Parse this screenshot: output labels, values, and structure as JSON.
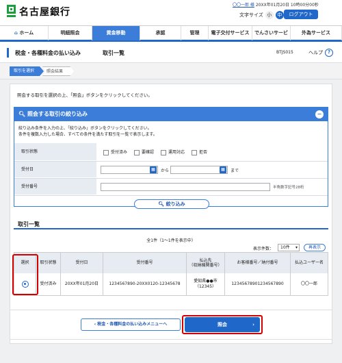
{
  "header": {
    "bank_name": "名古屋銀行",
    "user_prefix": "",
    "user_name": "〇〇一郎 様",
    "last_login": "20XX年01月20日 10時00分00秒",
    "font_size_label": "文字サイズ",
    "font_small": "小",
    "font_medium": "中",
    "font_large": "大",
    "logout": "ログアウト"
  },
  "nav": {
    "items": [
      "ホーム",
      "明細照会",
      "資金移動",
      "承認",
      "管理",
      "電子交付サービス",
      "でんさいサービス",
      "外為サービス"
    ],
    "active": "資金移動"
  },
  "subheader": {
    "title": "税金・各種料金の払い込み",
    "subtitle": "取引一覧",
    "screen_id": "BTJS015",
    "help": "ヘルプ"
  },
  "steps": [
    "取引を選択",
    "照会結果"
  ],
  "instruction": "照会する取引を選択の上、「照会」ボタンをクリックしてください。",
  "filter": {
    "title": "照会する取引の絞り込み",
    "desc1": "絞り込み条件を入力の上、「絞り込み」ボタンをクリックしてください。",
    "desc2": "条件を複数入力した場合、すべての条件を満たす取引を一覧で表示します。",
    "status_label": "取引状態",
    "status_options": [
      "受付済み",
      "要確認",
      "運用対応",
      "拒否"
    ],
    "date_label": "受付日",
    "date_from": "から",
    "date_to": "まで",
    "number_label": "受付番号",
    "number_hint": "半角数字記号28桁",
    "button": "絞り込み"
  },
  "list": {
    "title": "取引一覧",
    "count_text": "全1件（1～1件を表示中）",
    "per_page_label": "表示件数：",
    "per_page_value": "10件",
    "redisplay": "再表示",
    "headers": [
      "選択",
      "取引状態",
      "受付日",
      "受付番号",
      "払込先\n（収納機関番号）",
      "お客様番号／納付番号",
      "払込ユーザー名"
    ],
    "rows": [
      {
        "status": "受付済み",
        "date": "20XX年01月20日",
        "number": "1234567890-20XX0120-12345678",
        "payee": "愛知県●●市",
        "payee_code": "（12345）",
        "customer_no": "12345678901234567890",
        "user": "〇〇一郎"
      }
    ]
  },
  "buttons": {
    "back": "税金・各種料金の払い込みメニューへ",
    "inquiry": "照会"
  }
}
